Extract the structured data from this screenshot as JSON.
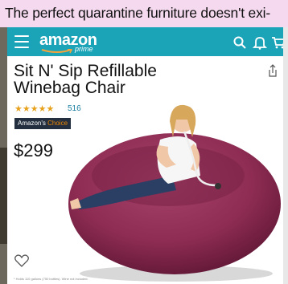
{
  "caption": {
    "text": "The perfect quarantine furniture doesn't exi-"
  },
  "header": {
    "logo": "amazon",
    "logo_sub": "prime",
    "icons": [
      "menu-icon",
      "search-icon",
      "notification-icon",
      "cart-icon"
    ],
    "color": "#1ba3b8"
  },
  "product": {
    "title": "Sit N' Sip Refillable Winebag Chair",
    "rating_stars": "★★★★★",
    "rating_value": 4.5,
    "review_count": "516",
    "badge_prefix": "Amazon's",
    "badge_highlight": "Choice",
    "price": "$299",
    "footnote": "* Holds 110 gallons (750 bottles). Wine not included.",
    "image_dots": 3,
    "active_dot": 1
  },
  "colors": {
    "beanbag": "#8e2c53",
    "star": "#e7a21d",
    "link": "#1a7ea1",
    "badge_bg": "#232f3e",
    "badge_accent": "#f08804"
  }
}
